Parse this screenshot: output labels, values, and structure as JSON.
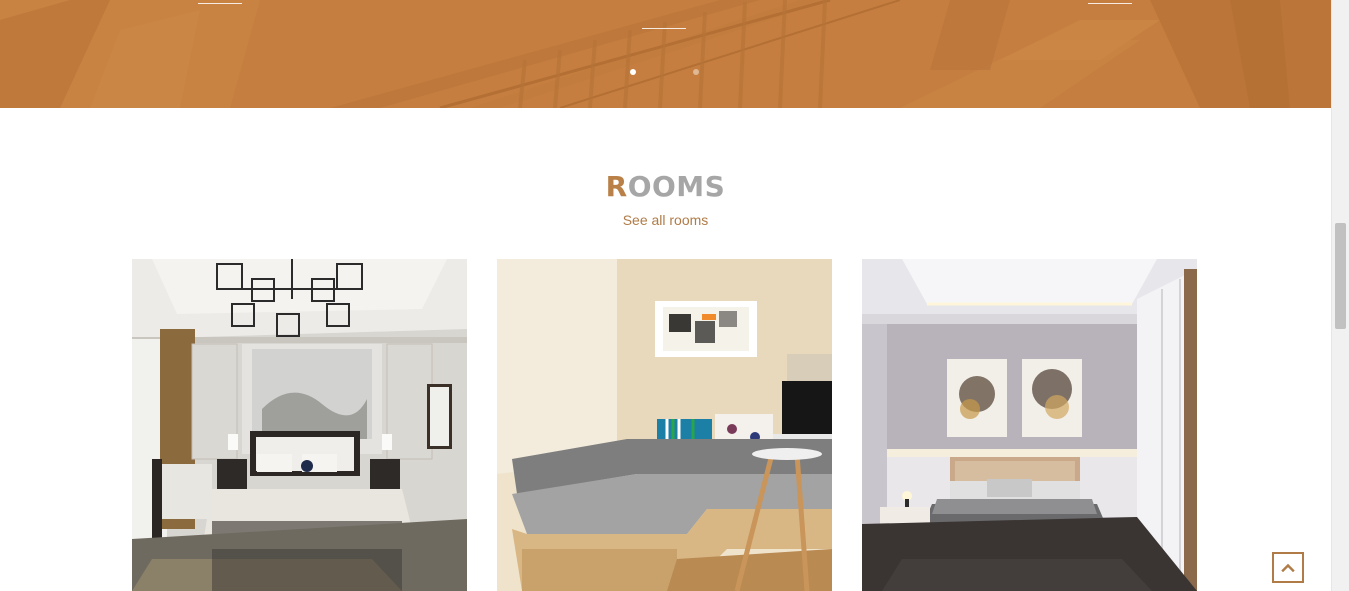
{
  "hero": {
    "slides_total": 2,
    "active_slide": 1
  },
  "rooms": {
    "title_first_letter": "R",
    "title_rest": "OOMS",
    "see_all_label": "See all rooms",
    "cards": [
      {
        "image": "chinese-style-bedroom-photo"
      },
      {
        "image": "reading-nook-sofa-photo"
      },
      {
        "image": "modern-bedroom-with-wardrobe-photo"
      }
    ]
  },
  "back_to_top": {
    "icon": "chevron-up-icon"
  },
  "colors": {
    "accent": "#b07b47",
    "hero_background": "#c57f3f",
    "title_gray": "#a6a6a6"
  }
}
